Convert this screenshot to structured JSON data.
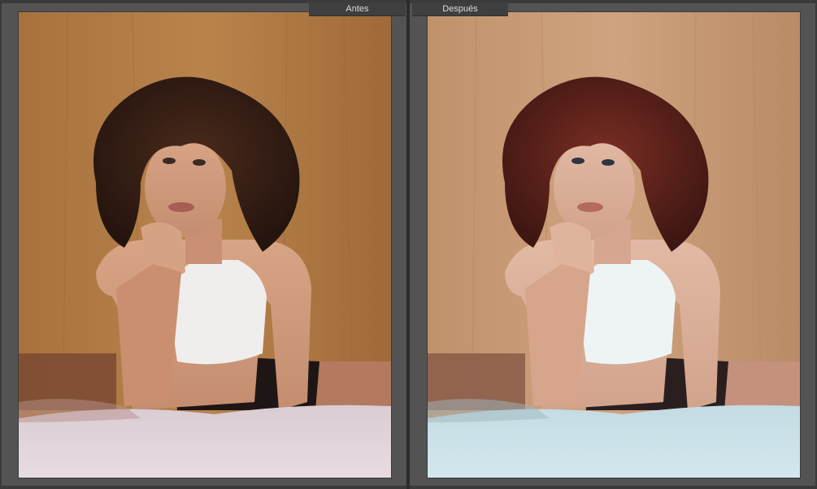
{
  "compare_view": {
    "before_label": "Antes",
    "after_label": "Después"
  },
  "colors": {
    "panel_background": "#535353",
    "before_wall": "#b07a45",
    "after_wall": "#c79a75",
    "before_sheet": "#e4d7de",
    "after_sheet": "#cfe3ea"
  },
  "icons": [
    "portrait-photo-before",
    "portrait-photo-after"
  ]
}
